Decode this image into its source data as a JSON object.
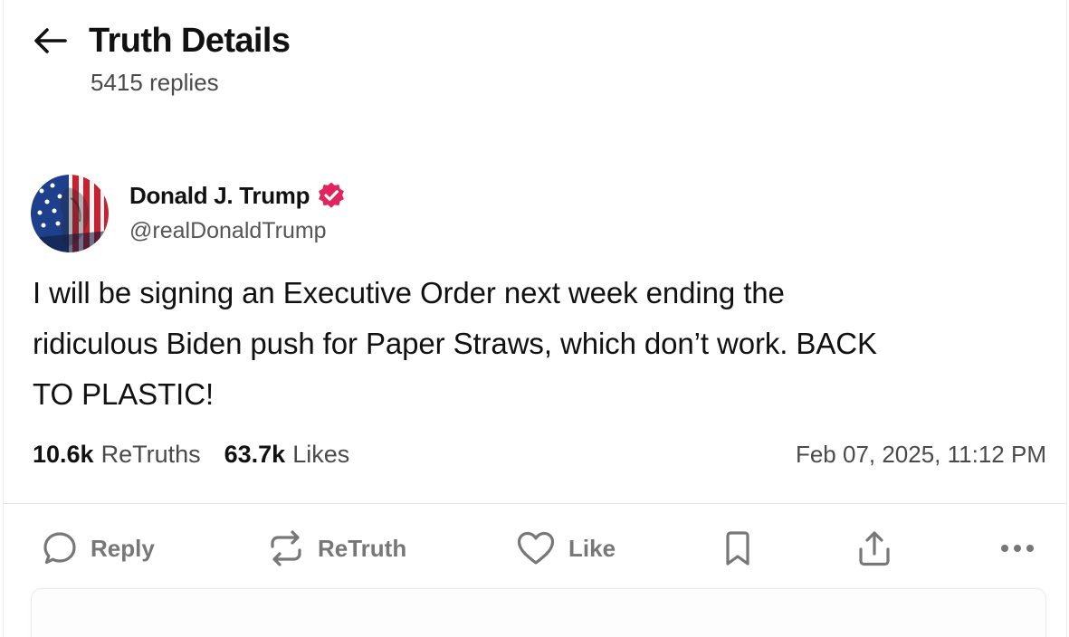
{
  "header": {
    "title": "Truth Details",
    "replies": "5415 replies"
  },
  "author": {
    "display_name": "Donald J. Trump",
    "handle": "@realDonaldTrump",
    "verified_badge_color": "#e0245e"
  },
  "post": {
    "text": "I will be signing an Executive Order next week ending the ridiculous Biden push for Paper Straws, which don’t work. BACK TO PLASTIC!",
    "lines": [
      "I will be signing an Executive Order next week ending the",
      "ridiculous Biden push for Paper Straws, which don’t work. BACK",
      "TO PLASTIC!"
    ]
  },
  "stats": {
    "retruths_count": "10.6k",
    "retruths_label": "ReTruths",
    "likes_count": "63.7k",
    "likes_label": "Likes",
    "timestamp": "Feb 07, 2025, 11:12 PM"
  },
  "actions": {
    "reply_label": "Reply",
    "retruth_label": "ReTruth",
    "like_label": "Like",
    "icons": [
      "reply-icon",
      "retruth-icon",
      "heart-icon",
      "bookmark-icon",
      "share-icon",
      "more-icon"
    ]
  },
  "colors": {
    "text_primary": "#111111",
    "text_secondary": "#4a4a4a",
    "action_gray": "#777777",
    "divider": "#e4e4e4"
  }
}
